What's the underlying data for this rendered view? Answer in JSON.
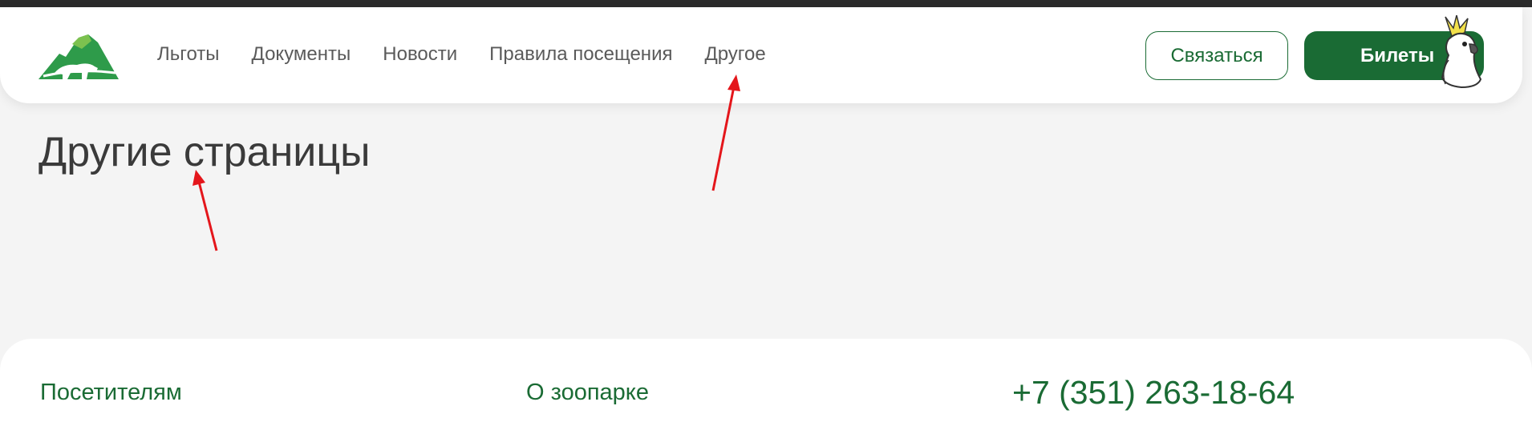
{
  "header": {
    "nav": [
      {
        "label": "Льготы"
      },
      {
        "label": "Документы"
      },
      {
        "label": "Новости"
      },
      {
        "label": "Правила посещения"
      },
      {
        "label": "Другое"
      }
    ],
    "contact_label": "Связаться",
    "tickets_label": "Билеты"
  },
  "main": {
    "title": "Другие страницы"
  },
  "footer": {
    "visitors_label": "Посетителям",
    "about_label": "О зоопарке",
    "phone": "+7 (351) 263-18-64"
  },
  "colors": {
    "brand_green": "#1a6b34",
    "logo_green": "#2e9b4a",
    "annotation_red": "#e4161b"
  },
  "icons": {
    "logo": "zoo-logo-icon",
    "mascot": "cockatoo-icon"
  }
}
